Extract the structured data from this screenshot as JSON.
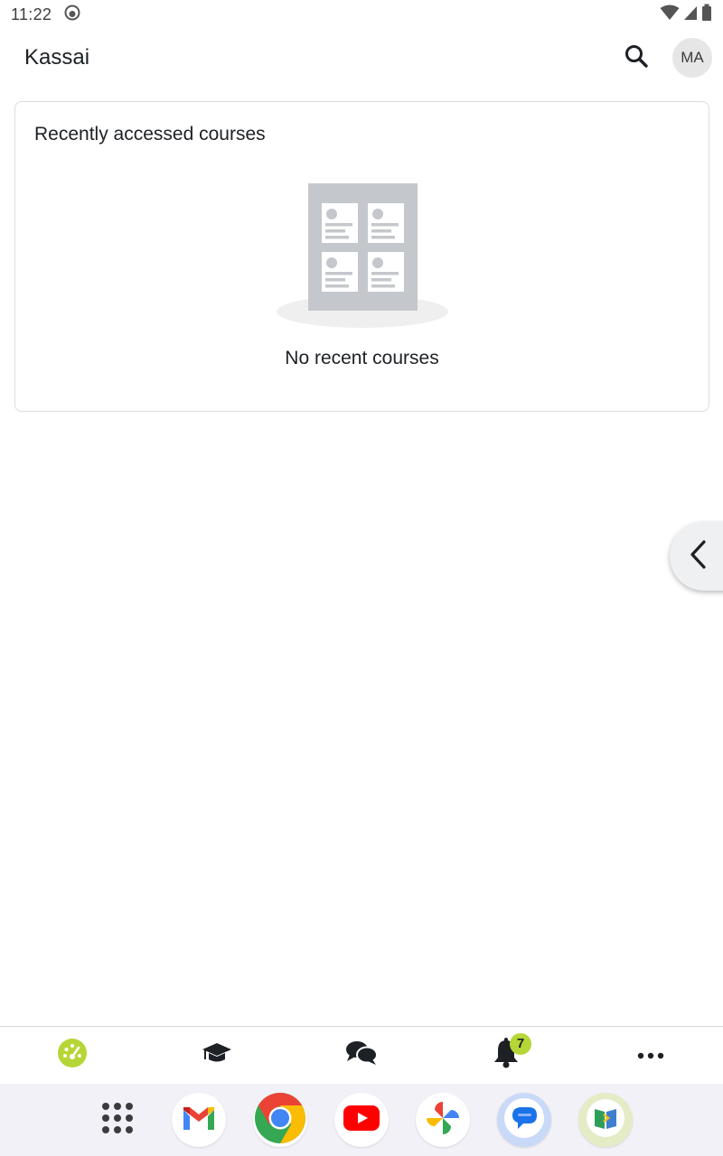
{
  "status_bar": {
    "time": "11:22",
    "icons": [
      "notification-face-icon",
      "wifi-icon",
      "cellular-signal-icon",
      "battery-icon"
    ]
  },
  "header": {
    "title": "Kassai",
    "search_icon": "search-icon",
    "avatar_initials": "MA"
  },
  "recent_courses": {
    "title": "Recently accessed courses",
    "empty_message": "No recent courses",
    "illustration": "courses-empty-illustration"
  },
  "drawer_handle": {
    "icon": "chevron-left-icon"
  },
  "tabs": [
    {
      "id": "dashboard",
      "icon": "dashboard-gauge-icon",
      "active": true
    },
    {
      "id": "my-courses",
      "icon": "graduation-cap-icon",
      "active": false
    },
    {
      "id": "messages",
      "icon": "chat-bubbles-icon",
      "active": false
    },
    {
      "id": "notifications",
      "icon": "bell-icon",
      "active": false,
      "badge": "7"
    },
    {
      "id": "more",
      "icon": "more-dots-icon",
      "active": false
    }
  ],
  "dock": {
    "apps": [
      "app-drawer-icon",
      "gmail-icon",
      "chrome-icon",
      "youtube-icon",
      "photos-icon",
      "messages-icon",
      "moodle-app-icon"
    ]
  },
  "colors": {
    "accent": "#b6d637",
    "text": "#1d2125",
    "card_border": "#dcdcdc",
    "placeholder_gray": "#c4c7cc"
  }
}
